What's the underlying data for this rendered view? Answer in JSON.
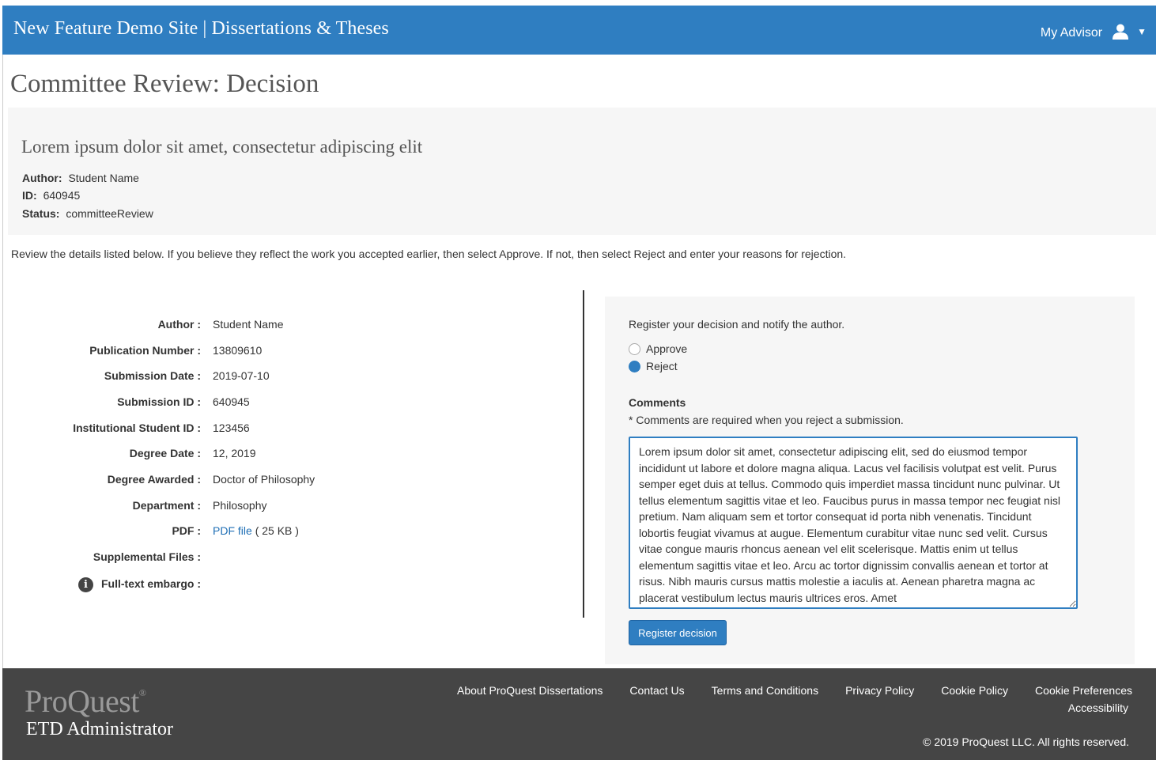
{
  "header": {
    "site_title": "New Feature Demo Site | Dissertations & Theses",
    "user_name": "My Advisor",
    "user_icon": "user-icon",
    "caret": "▼",
    "brand_color": "#2f7ec1"
  },
  "page": {
    "title": "Committee Review: Decision"
  },
  "summary": {
    "title": "Lorem ipsum dolor sit amet, consectetur adipiscing elit",
    "author_label": "Author:",
    "author_value": "Student Name",
    "id_label": "ID:",
    "id_value": "640945",
    "status_label": "Status:",
    "status_value": "committeeReview"
  },
  "instructions": "Review the details listed below. If you believe they reflect the work you accepted earlier, then select Approve. If not, then select Reject and enter your reasons for rejection.",
  "details": {
    "author": {
      "label": "Author :",
      "value": "Student Name"
    },
    "publication_number": {
      "label": "Publication Number :",
      "value": "13809610"
    },
    "submission_date": {
      "label": "Submission Date :",
      "value": "2019-07-10"
    },
    "submission_id": {
      "label": "Submission ID :",
      "value": "640945"
    },
    "institutional_student_id": {
      "label": "Institutional Student ID :",
      "value": "123456"
    },
    "degree_date": {
      "label": "Degree Date :",
      "value": "12, 2019"
    },
    "degree_awarded": {
      "label": "Degree Awarded :",
      "value": "Doctor of Philosophy"
    },
    "department": {
      "label": "Department :",
      "value": "Philosophy"
    },
    "pdf": {
      "label": "PDF :",
      "link_text": "PDF file",
      "size": "( 25 KB )"
    },
    "supplemental_files": {
      "label": "Supplemental Files :"
    },
    "full_text_embargo": {
      "label": "Full-text embargo :",
      "icon": "info-icon",
      "icon_glyph": "i"
    }
  },
  "decision": {
    "prompt": "Register your decision and notify the author.",
    "options": [
      {
        "label": "Approve",
        "checked": false
      },
      {
        "label": "Reject",
        "checked": true
      }
    ],
    "comments_label": "Comments",
    "comments_note": "* Comments are required when you reject a submission.",
    "comments_value": "Lorem ipsum dolor sit amet, consectetur adipiscing elit, sed do eiusmod tempor incididunt ut labore et dolore magna aliqua. Lacus vel facilisis volutpat est velit. Purus semper eget duis at tellus. Commodo quis imperdiet massa tincidunt nunc pulvinar. Ut tellus elementum sagittis vitae et leo. Faucibus purus in massa tempor nec feugiat nisl pretium. Nam aliquam sem et tortor consequat id porta nibh venenatis. Tincidunt lobortis feugiat vivamus at augue. Elementum curabitur vitae nunc sed velit. Cursus vitae congue mauris rhoncus aenean vel elit scelerisque. Mattis enim ut tellus elementum sagittis vitae et leo. Arcu ac tortor dignissim convallis aenean et tortor at risus. Nibh mauris cursus mattis molestie a iaculis at. Aenean pharetra magna ac placerat vestibulum lectus mauris ultrices eros. Amet",
    "register_button": "Register decision"
  },
  "footer": {
    "logo_text": "ProQuest",
    "logo_mark": "®",
    "product_name": "ETD Administrator",
    "links": [
      "About ProQuest Dissertations",
      "Contact Us",
      "Terms and Conditions",
      "Privacy Policy",
      "Cookie Policy",
      "Cookie Preferences"
    ],
    "accessibility": "Accessibility",
    "copyright": "© 2019 ProQuest LLC. All rights reserved."
  }
}
